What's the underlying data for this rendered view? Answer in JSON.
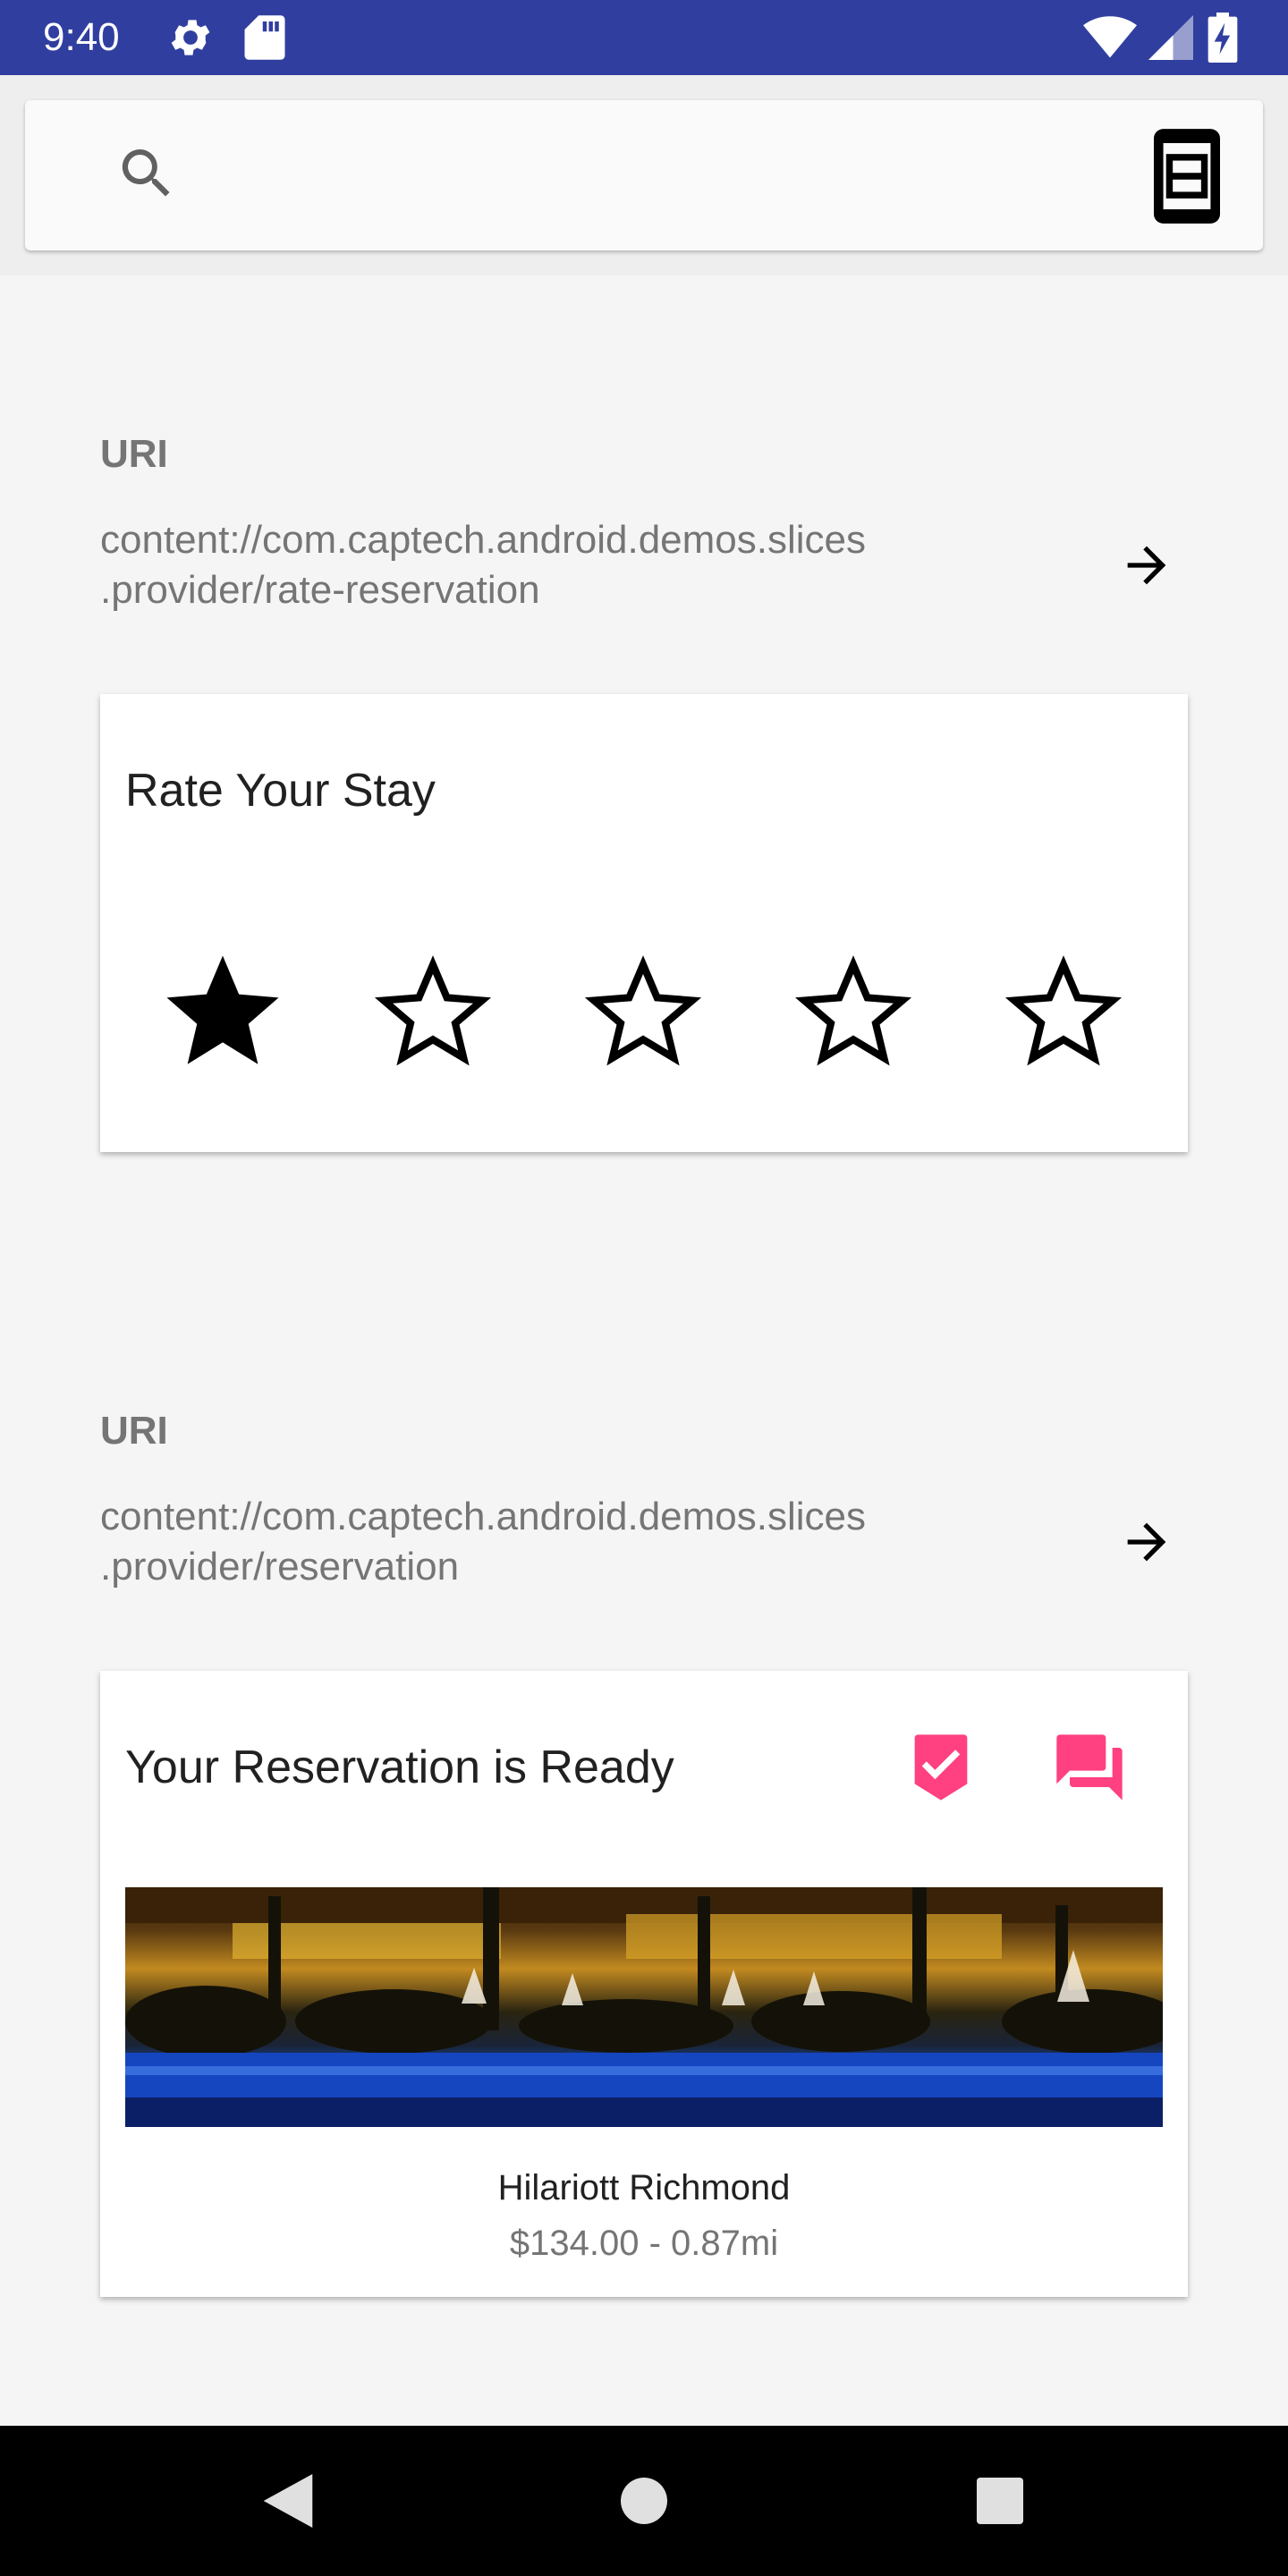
{
  "status_bar": {
    "time": "9:40",
    "icons": [
      "gear-icon",
      "sd-card-icon",
      "wifi-icon",
      "cell-signal-icon",
      "battery-charging-icon"
    ],
    "bg_color": "#303f9f"
  },
  "search_bar": {
    "search_icon": "search-icon",
    "action_icon": "device-icon"
  },
  "sections": [
    {
      "uri_label": "URI",
      "uri_text": "content://com.captech.android.demos.slices\n.provider/rate-reservation",
      "card": {
        "title": "Rate Your Stay",
        "rating": 1,
        "max_rating": 5
      }
    },
    {
      "uri_label": "URI",
      "uri_text": "content://com.captech.android.demos.slices\n.provider/reservation",
      "card": {
        "title": "Your Reservation is Ready",
        "hotel_name": "Hilariott Richmond",
        "hotel_meta": "$134.00 - 0.87mi",
        "accent_color": "#ff4081"
      }
    }
  ],
  "nav_bar": {
    "buttons": [
      "back-icon",
      "home-icon",
      "recents-icon"
    ]
  }
}
